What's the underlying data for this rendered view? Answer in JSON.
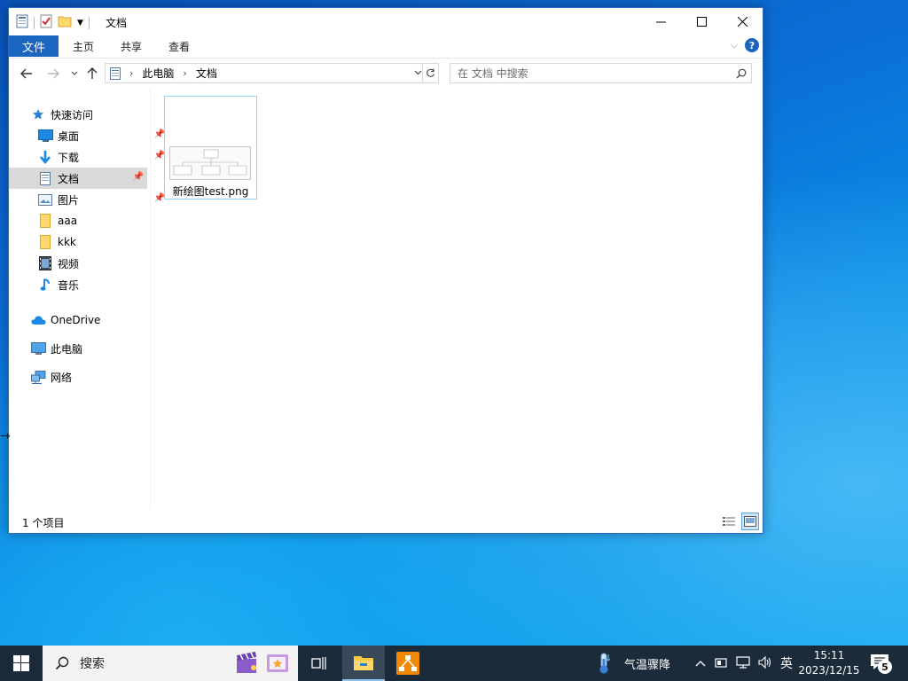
{
  "window": {
    "title": "文档",
    "controls": {
      "minimize": "—",
      "maximize": "☐",
      "close": "✕"
    }
  },
  "ribbon": {
    "tabs": [
      "文件",
      "主页",
      "共享",
      "查看"
    ],
    "help": "?"
  },
  "address": {
    "crumbs": [
      "此电脑",
      "文档"
    ]
  },
  "search": {
    "placeholder": "在 文档 中搜索"
  },
  "nav": {
    "quick_access": "快速访问",
    "items": [
      {
        "label": "桌面",
        "icon": "desktop-icon",
        "pinned": true
      },
      {
        "label": "下载",
        "icon": "download-icon",
        "pinned": true
      },
      {
        "label": "文档",
        "icon": "documents-icon",
        "pinned": true,
        "selected": true
      },
      {
        "label": "图片",
        "icon": "pictures-icon",
        "pinned": true
      },
      {
        "label": "aaa",
        "icon": "folder-icon",
        "pinned": false
      },
      {
        "label": "kkk",
        "icon": "folder-icon",
        "pinned": false
      },
      {
        "label": "视频",
        "icon": "videos-icon",
        "pinned": false
      },
      {
        "label": "音乐",
        "icon": "music-icon",
        "pinned": false
      }
    ],
    "onedrive": "OneDrive",
    "this_pc": "此电脑",
    "network": "网络"
  },
  "files": [
    {
      "name": "新绘图test.png",
      "icon": "image-thumbnail"
    }
  ],
  "status": {
    "count_text": "1 个项目"
  },
  "taskbar": {
    "search_label": "搜索",
    "weather_text": "气温骤降",
    "ime": "英",
    "time": "15:11",
    "date": "2023/12/15",
    "notification_count": "5"
  },
  "colors": {
    "accent": "#1a65c0",
    "selected_bg": "#d9d9d9",
    "taskbar": "#1c2b3a"
  }
}
